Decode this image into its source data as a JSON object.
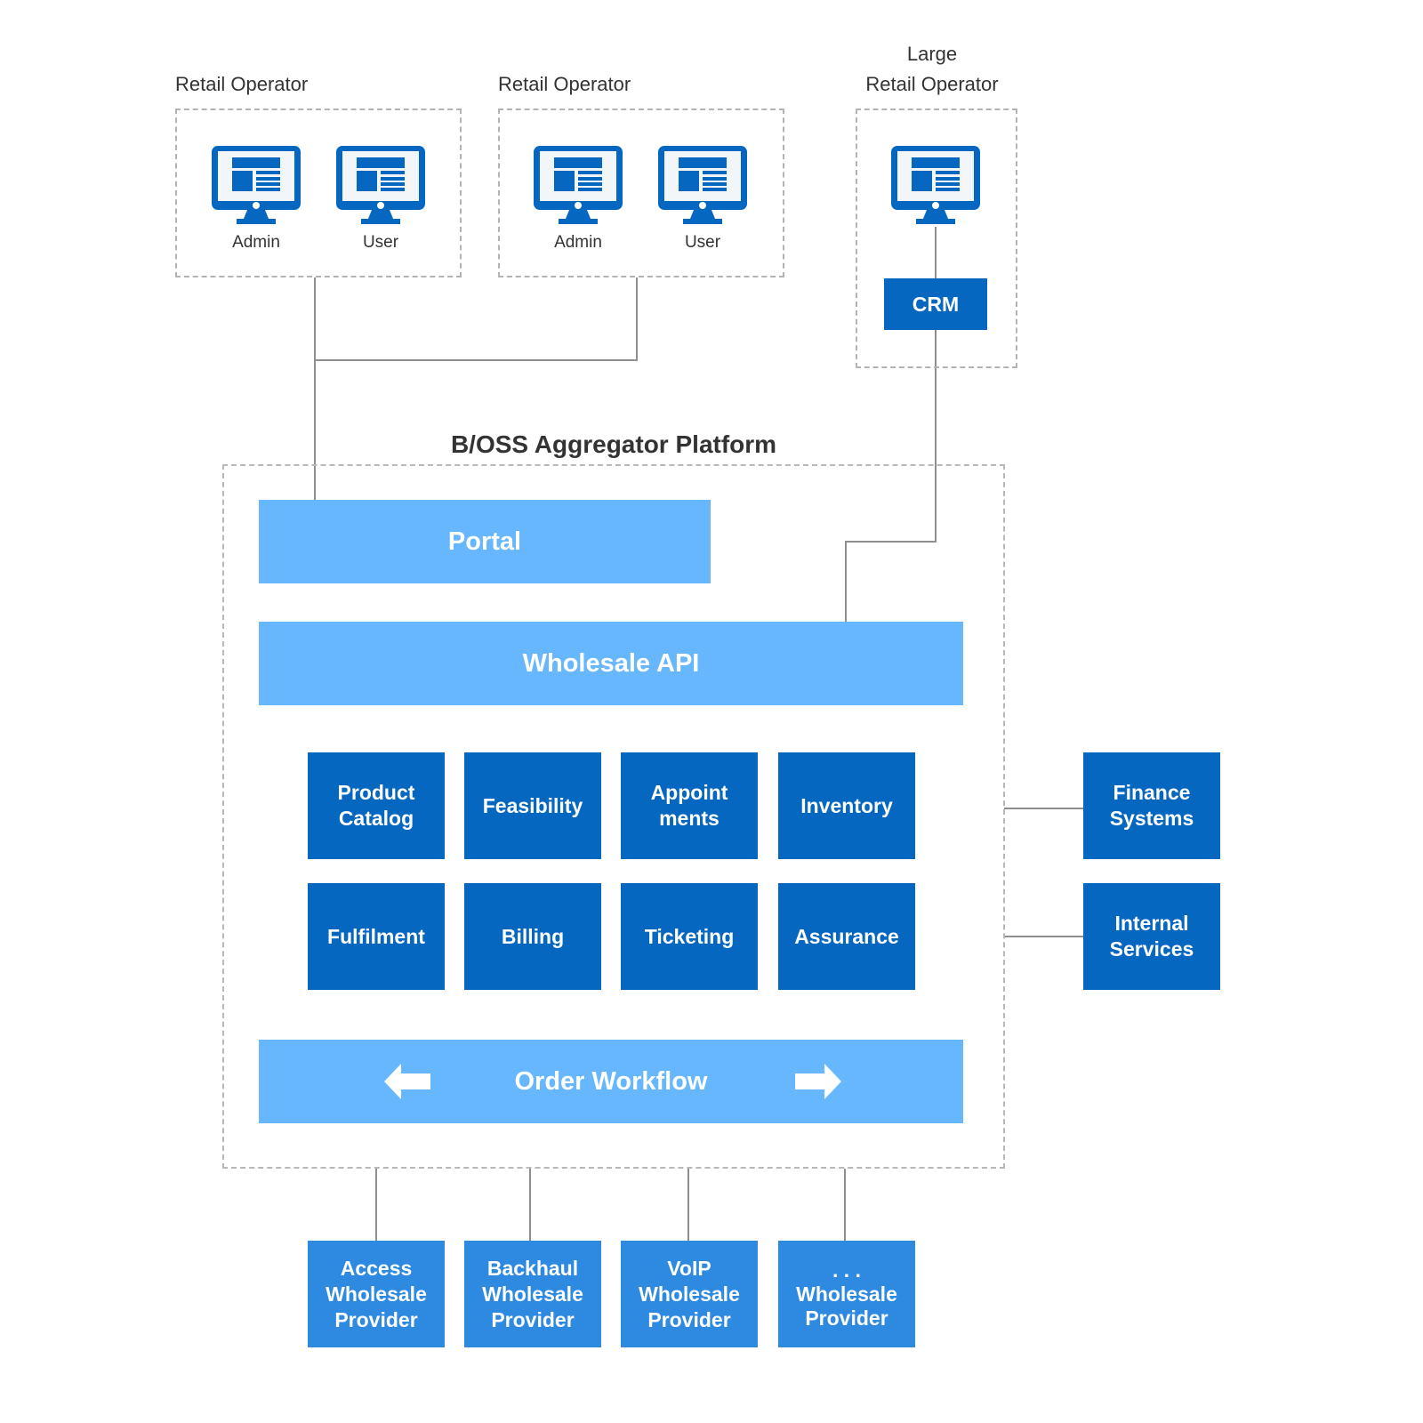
{
  "operators": [
    {
      "label": "Retail Operator",
      "devices": [
        "Admin",
        "User"
      ]
    },
    {
      "label": "Retail Operator",
      "devices": [
        "Admin",
        "User"
      ]
    },
    {
      "label_line1": "Large",
      "label_line2": "Retail Operator",
      "crm": "CRM"
    }
  ],
  "platform": {
    "title": "B/OSS Aggregator Platform",
    "portal": "Portal",
    "wholesale_api": "Wholesale API",
    "modules_row1": [
      "Product\nCatalog",
      "Feasibility",
      "Appoint\nments",
      "Inventory"
    ],
    "modules_row2": [
      "Fulfilment",
      "Billing",
      "Ticketing",
      "Assurance"
    ],
    "order_workflow": "Order Workflow"
  },
  "external": [
    "Finance\nSystems",
    "Internal\nServices"
  ],
  "providers": [
    "Access\nWholesale\nProvider",
    "Backhaul\nWholesale\nProvider",
    "VoIP\nWholesale\nProvider",
    ". . .\nWholesale\nProvider"
  ],
  "colors": {
    "dark_blue": "#0567c0",
    "mid_blue": "#2e8ae0",
    "light_blue": "#66b7fd",
    "line_gray": "#8f8f8f"
  }
}
